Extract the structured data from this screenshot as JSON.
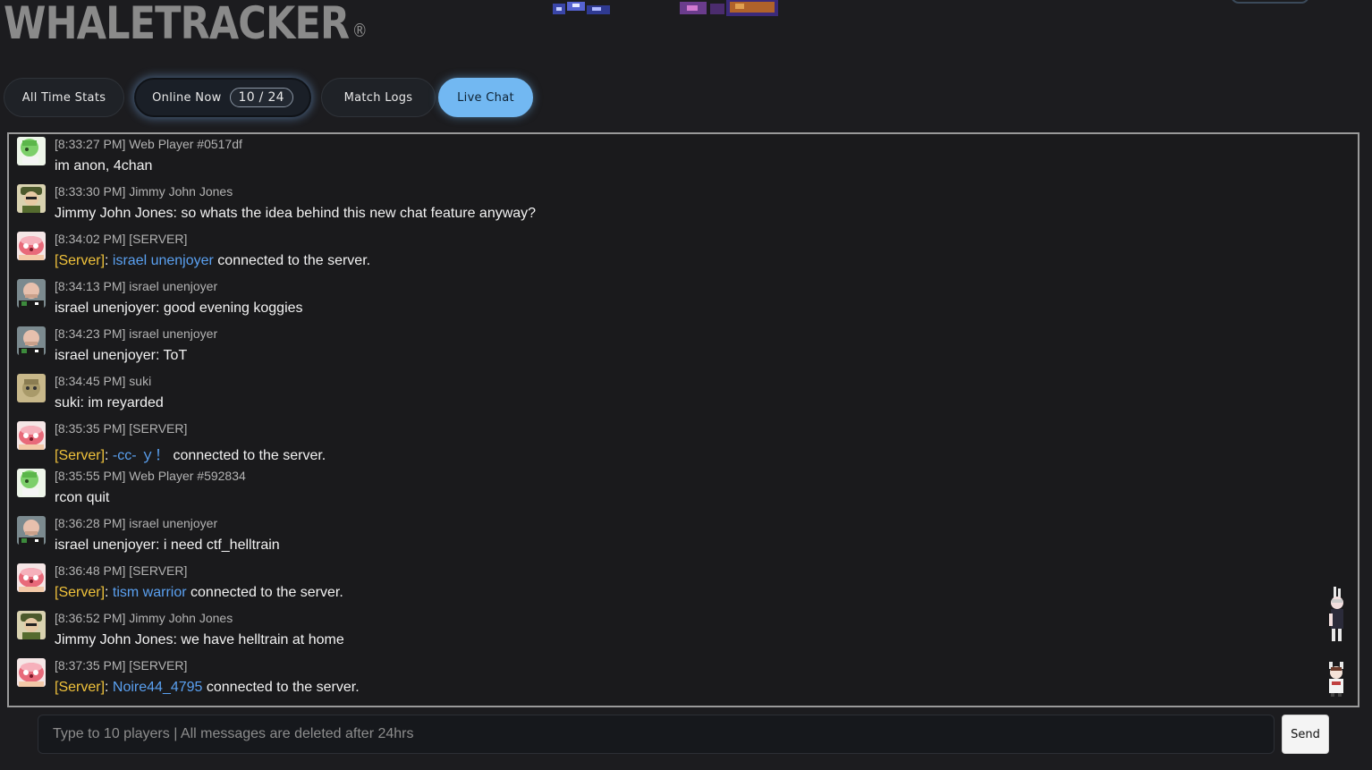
{
  "header": {
    "logo_text": "WHALETRACKER",
    "logo_mark": "®"
  },
  "tabs": [
    {
      "label": "All Time Stats",
      "active": false
    },
    {
      "label": "Online Now",
      "badge": "10 / 24",
      "active": false
    },
    {
      "label": "Match Logs",
      "active": false
    },
    {
      "label": "Live Chat",
      "active": true
    }
  ],
  "chat": {
    "messages": [
      {
        "time": "[8:33:27 PM]",
        "sender": "Web Player #0517df",
        "avatar": "web-player-avatar-icon",
        "parts": [
          {
            "t": "im anon, 4chan"
          }
        ]
      },
      {
        "time": "[8:33:30 PM]",
        "sender": "Jimmy John Jones",
        "avatar": "soldier-avatar-icon",
        "parts": [
          {
            "t": "Jimmy John Jones: so whats the idea behind this new chat feature anyway?"
          }
        ]
      },
      {
        "time": "[8:34:02 PM]",
        "sender": "[SERVER]",
        "avatar": "server-avatar-icon",
        "parts": [
          {
            "t": "[Server]",
            "c": "srv"
          },
          {
            "t": ": "
          },
          {
            "t": "israel unenjoyer",
            "c": "pname"
          },
          {
            "t": " connected to the server."
          }
        ]
      },
      {
        "time": "[8:34:13 PM]",
        "sender": "israel unenjoyer",
        "avatar": "man-avatar-icon",
        "parts": [
          {
            "t": "israel unenjoyer: good evening koggies"
          }
        ]
      },
      {
        "time": "[8:34:23 PM]",
        "sender": "israel unenjoyer",
        "avatar": "man-avatar-icon",
        "parts": [
          {
            "t": "israel unenjoyer: ToT"
          }
        ]
      },
      {
        "time": "[8:34:45 PM]",
        "sender": "suki",
        "avatar": "cat-avatar-icon",
        "parts": [
          {
            "t": "suki: im reyarded"
          }
        ]
      },
      {
        "time": "[8:35:35 PM]",
        "sender": "[SERVER]",
        "avatar": "server-avatar-icon",
        "parts": [
          {
            "t": "[Server]",
            "c": "srv"
          },
          {
            "t": ": "
          },
          {
            "t": "-cc- ｙ！",
            "c": "pname"
          },
          {
            "t": " connected to the server."
          }
        ]
      },
      {
        "time": "[8:35:55 PM]",
        "sender": "Web Player #592834",
        "avatar": "web-player-avatar-icon",
        "parts": [
          {
            "t": "rcon quit"
          }
        ]
      },
      {
        "time": "[8:36:28 PM]",
        "sender": "israel unenjoyer",
        "avatar": "man-avatar-icon",
        "parts": [
          {
            "t": "israel unenjoyer: i need ctf_helltrain"
          }
        ]
      },
      {
        "time": "[8:36:48 PM]",
        "sender": "[SERVER]",
        "avatar": "server-avatar-icon",
        "parts": [
          {
            "t": "[Server]",
            "c": "srv"
          },
          {
            "t": ": "
          },
          {
            "t": "tism warrior",
            "c": "pname"
          },
          {
            "t": " connected to the server."
          }
        ]
      },
      {
        "time": "[8:36:52 PM]",
        "sender": "Jimmy John Jones",
        "avatar": "soldier-avatar-icon",
        "parts": [
          {
            "t": "Jimmy John Jones: we have helltrain at home"
          }
        ]
      },
      {
        "time": "[8:37:35 PM]",
        "sender": "[SERVER]",
        "avatar": "server-avatar-icon",
        "parts": [
          {
            "t": "[Server]",
            "c": "srv"
          },
          {
            "t": ": "
          },
          {
            "t": "Noire44_4795",
            "c": "pname"
          },
          {
            "t": " connected to the server."
          }
        ]
      }
    ]
  },
  "composer": {
    "placeholder": "Type to 10 players | All messages are deleted after 24hrs",
    "send_label": "Send"
  },
  "colors": {
    "accent": "#72b8f2",
    "server_tag": "#f0c23b",
    "player_link": "#5aa0f0",
    "background": "#1c1c1f"
  }
}
